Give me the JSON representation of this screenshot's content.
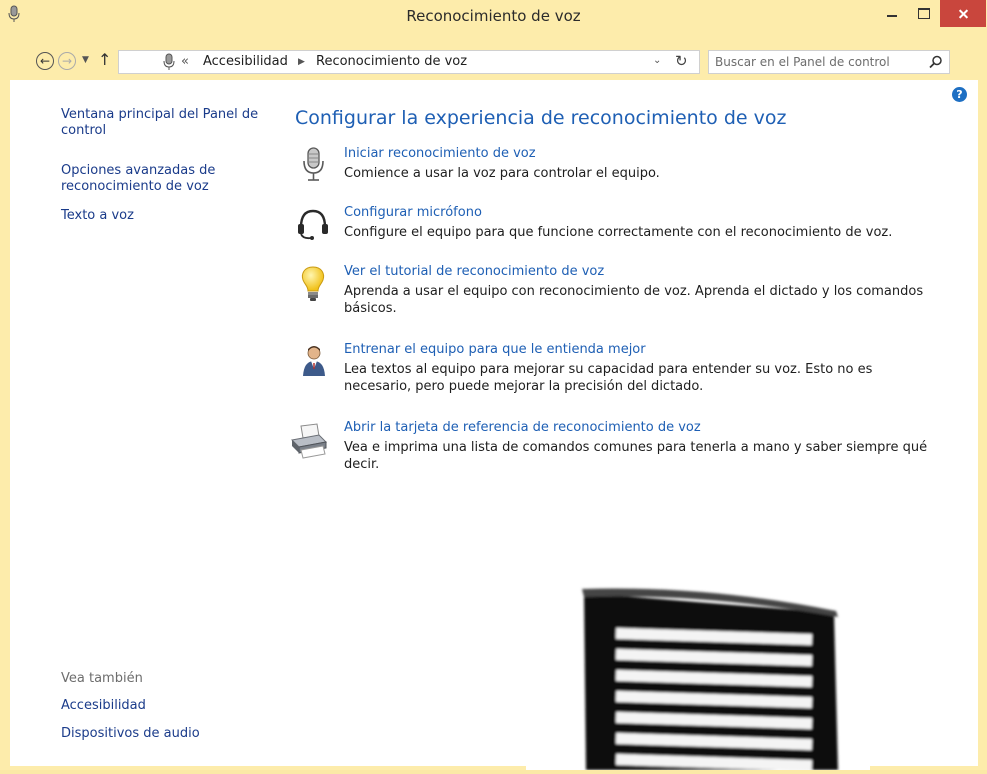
{
  "window": {
    "title": "Reconocimiento de voz"
  },
  "address": {
    "overflow": "«",
    "crumbs": [
      "Accesibilidad",
      "Reconocimiento de voz"
    ],
    "search_placeholder": "Buscar en el Panel de control"
  },
  "sidebar": {
    "links": [
      "Ventana principal del Panel de control",
      "Opciones avanzadas de reconocimiento de voz",
      "Texto a voz"
    ],
    "see_also_label": "Vea también",
    "see_also": [
      "Accesibilidad",
      "Dispositivos de audio"
    ]
  },
  "main": {
    "title": "Configurar la experiencia de reconocimiento de voz",
    "tasks": [
      {
        "icon": "microphone-icon",
        "link": "Iniciar reconocimiento de voz",
        "desc": "Comience a usar la voz para controlar el equipo."
      },
      {
        "icon": "headset-icon",
        "link": "Configurar micrófono",
        "desc": "Configure el equipo para que funcione correctamente con el reconocimiento de voz."
      },
      {
        "icon": "lightbulb-icon",
        "link": "Ver el tutorial de reconocimiento de voz",
        "desc": "Aprenda a usar el equipo con reconocimiento de voz. Aprenda el dictado y los comandos básicos."
      },
      {
        "icon": "user-train-icon",
        "link": "Entrenar el equipo para que le entienda mejor",
        "desc": "Lea textos al equipo para mejorar su capacidad para entender su voz. Esto no es necesario, pero puede mejorar la precisión del dictado."
      },
      {
        "icon": "printer-icon",
        "link": "Abrir la tarjeta de referencia de reconocimiento de voz",
        "desc": "Vea e imprima una lista de comandos comunes para tenerla a mano y saber siempre qué decir."
      }
    ]
  },
  "colors": {
    "frame": "#fdecab",
    "link": "#1e5fb4",
    "close": "#c9463d"
  }
}
